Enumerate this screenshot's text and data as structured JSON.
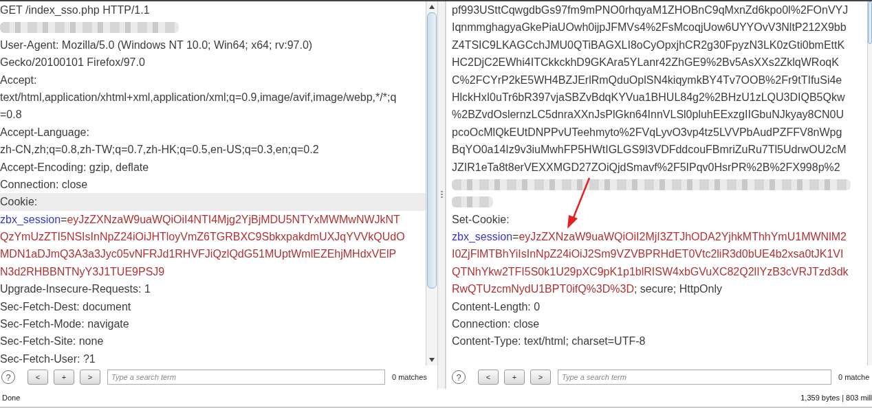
{
  "request": {
    "lines": [
      {
        "kind": "text",
        "highlighted": false,
        "segments": [
          {
            "kind": "plain",
            "text": "GET /index_sso.php HTTP/1.1"
          }
        ]
      },
      {
        "kind": "blurmedium",
        "highlighted": false
      },
      {
        "kind": "text",
        "highlighted": false,
        "segments": [
          {
            "kind": "plain",
            "text": "User-Agent: Mozilla/5.0 (Windows NT 10.0; Win64; x64; rv:97.0)"
          }
        ]
      },
      {
        "kind": "text",
        "highlighted": false,
        "segments": [
          {
            "kind": "plain",
            "text": "Gecko/20100101 Firefox/97.0"
          }
        ]
      },
      {
        "kind": "text",
        "highlighted": false,
        "segments": [
          {
            "kind": "plain",
            "text": "Accept:"
          }
        ]
      },
      {
        "kind": "text",
        "highlighted": false,
        "segments": [
          {
            "kind": "plain",
            "text": "text/html,application/xhtml+xml,application/xml;q=0.9,image/avif,image/webp,*/*;q"
          }
        ]
      },
      {
        "kind": "text",
        "highlighted": false,
        "segments": [
          {
            "kind": "plain",
            "text": "=0.8"
          }
        ]
      },
      {
        "kind": "text",
        "highlighted": false,
        "segments": [
          {
            "kind": "plain",
            "text": "Accept-Language:"
          }
        ]
      },
      {
        "kind": "text",
        "highlighted": false,
        "segments": [
          {
            "kind": "plain",
            "text": "zh-CN,zh;q=0.8,zh-TW;q=0.7,zh-HK;q=0.5,en-US;q=0.3,en;q=0.2"
          }
        ]
      },
      {
        "kind": "text",
        "highlighted": false,
        "segments": [
          {
            "kind": "plain",
            "text": "Accept-Encoding: gzip, deflate"
          }
        ]
      },
      {
        "kind": "text",
        "highlighted": false,
        "segments": [
          {
            "kind": "plain",
            "text": "Connection: close"
          }
        ]
      },
      {
        "kind": "text",
        "highlighted": true,
        "segments": [
          {
            "kind": "plain",
            "text": "Cookie:"
          }
        ]
      },
      {
        "kind": "text",
        "highlighted": false,
        "segments": [
          {
            "kind": "name",
            "text": "zbx_session"
          },
          {
            "kind": "plain",
            "text": "="
          },
          {
            "kind": "value",
            "text": "eyJzZXNzaW9uaWQiOiI4NTI4Mjg2YjBjMDU5NTYxMWMwNWJkNT"
          }
        ]
      },
      {
        "kind": "text",
        "highlighted": false,
        "segments": [
          {
            "kind": "value",
            "text": "QzYmUzZTI5NSIsInNpZ24iOiJHTloyVmZ6TGRBXC9SbkxpakdmUXJqYVVkQUdO"
          }
        ]
      },
      {
        "kind": "text",
        "highlighted": false,
        "segments": [
          {
            "kind": "value",
            "text": "MDN1aDJmQ3A3a3Jyc05vNFRJd1RHVFJiQzlQdG51MUptWmlEZEhjMHdxVElP"
          }
        ]
      },
      {
        "kind": "text",
        "highlighted": false,
        "segments": [
          {
            "kind": "value",
            "text": "N3d2RHBBNTNyY3J1TUE9PSJ9"
          }
        ]
      },
      {
        "kind": "text",
        "highlighted": false,
        "segments": [
          {
            "kind": "plain",
            "text": "Upgrade-Insecure-Requests: 1"
          }
        ]
      },
      {
        "kind": "text",
        "highlighted": false,
        "segments": [
          {
            "kind": "plain",
            "text": "Sec-Fetch-Dest: document"
          }
        ]
      },
      {
        "kind": "text",
        "highlighted": false,
        "segments": [
          {
            "kind": "plain",
            "text": "Sec-Fetch-Mode: navigate"
          }
        ]
      },
      {
        "kind": "text",
        "highlighted": false,
        "segments": [
          {
            "kind": "plain",
            "text": "Sec-Fetch-Site: none"
          }
        ]
      },
      {
        "kind": "text",
        "highlighted": false,
        "segments": [
          {
            "kind": "plain",
            "text": "Sec-Fetch-User: ?1"
          }
        ]
      }
    ],
    "help": "?",
    "buttons": [
      "<",
      "+",
      ">"
    ],
    "search": {
      "placeholder": "Type a search term"
    },
    "matches": "0 matches"
  },
  "response": {
    "lines": [
      {
        "kind": "text",
        "highlighted": false,
        "segments": [
          {
            "kind": "plain",
            "text": "pf993USttCqwgdbGs97fm9mPNO0rhqyaM1ZHOBnC9qMxnZd6kpo0l%2FOnVYJ"
          }
        ]
      },
      {
        "kind": "text",
        "highlighted": false,
        "segments": [
          {
            "kind": "plain",
            "text": "IqnmmghagyaGkePiaUOwh0ijpJFMVs4%2FsMcoqjUow6UYYOvV3NltP212X9bb"
          }
        ]
      },
      {
        "kind": "text",
        "highlighted": false,
        "segments": [
          {
            "kind": "plain",
            "text": "Z4TSIC9LKAGCchJMU0QTiBAGXLI8oCyOpxjhCR2g30FpyzN3LK0zGti0bmEttK"
          }
        ]
      },
      {
        "kind": "text",
        "highlighted": false,
        "segments": [
          {
            "kind": "plain",
            "text": "HC2DjC2EWhi4ITCkkckhD9GKAra5YLanr42ZhGE9%2Bv5AsXXs2ZklqWRoqK"
          }
        ]
      },
      {
        "kind": "text",
        "highlighted": false,
        "segments": [
          {
            "kind": "plain",
            "text": "C%2FCYrP2kE5WH4BZJErlRmQduOplSN4kiqymkBY4Tv7OOB%2Fr9tTIfuSi4e"
          }
        ]
      },
      {
        "kind": "text",
        "highlighted": false,
        "segments": [
          {
            "kind": "plain",
            "text": "HlckHxI0uTr6bR397vjaSBZvBdqKYVua1BHUL84g2%2BHzU1zLQU3DIQB5Qkw"
          }
        ]
      },
      {
        "kind": "text",
        "highlighted": false,
        "segments": [
          {
            "kind": "plain",
            "text": "%2BZvdOslernzLC5dnraXXnJsPlGkn64InnVLSl0pluhEExzgIIGbuNJkyay8CN0U"
          }
        ]
      },
      {
        "kind": "text",
        "highlighted": false,
        "segments": [
          {
            "kind": "plain",
            "text": "pcoOcMlQkEUtDNPPvUTeehmyto%2FVqLyvO3vp4tz5LVVPbAudPZFFV8nWpg"
          }
        ]
      },
      {
        "kind": "text",
        "highlighted": false,
        "segments": [
          {
            "kind": "plain",
            "text": "BqYO0a14Iz9v3iuMwhFP5HWtIGLGS9l3VDFddcouFBmriZuRu7Tl5UdrwOU2cM"
          }
        ]
      },
      {
        "kind": "text",
        "highlighted": false,
        "segments": [
          {
            "kind": "plain",
            "text": "JZIR1eTa8t8erVEXXMGD27ZOiQjdSmavf%2F5IPqv0HsrPR%2B%2FX998p%2"
          }
        ]
      },
      {
        "kind": "blurlong",
        "highlighted": false
      },
      {
        "kind": "blurshort",
        "highlighted": false
      },
      {
        "kind": "text",
        "highlighted": false,
        "segments": [
          {
            "kind": "plain",
            "text": "Set-Cookie:"
          }
        ]
      },
      {
        "kind": "text",
        "highlighted": false,
        "segments": [
          {
            "kind": "name",
            "text": "zbx_session"
          },
          {
            "kind": "plain",
            "text": "="
          },
          {
            "kind": "value",
            "text": "eyJzZXNzaW9uaWQiOiI2MjI3ZTJhODA2YjhkMThhYmU1MWNlM2"
          }
        ]
      },
      {
        "kind": "text",
        "highlighted": false,
        "segments": [
          {
            "kind": "value",
            "text": "I0ZjFlMTBhYiIsInNpZ24iOiJ2Sm9VZVBPRHdET0Vtc2liR3d0bUE4b2xsa0tJK1VI"
          }
        ]
      },
      {
        "kind": "text",
        "highlighted": false,
        "segments": [
          {
            "kind": "value",
            "text": "QTNhYkw2TFI5S0k1U29pXC9pK1p1blRISW4xbGVuXC82Q2lIYzB3cVRJTzd3dk"
          }
        ]
      },
      {
        "kind": "text",
        "highlighted": false,
        "segments": [
          {
            "kind": "value",
            "text": "RwQTUzcmNydU1BPT0ifQ%3D%3D"
          },
          {
            "kind": "plain",
            "text": "; secure; HttpOnly"
          }
        ]
      },
      {
        "kind": "text",
        "highlighted": false,
        "segments": [
          {
            "kind": "plain",
            "text": "Content-Length: 0"
          }
        ]
      },
      {
        "kind": "text",
        "highlighted": false,
        "segments": [
          {
            "kind": "plain",
            "text": "Connection: close"
          }
        ]
      },
      {
        "kind": "text",
        "highlighted": false,
        "segments": [
          {
            "kind": "plain",
            "text": "Content-Type: text/html; charset=UTF-8"
          }
        ]
      }
    ],
    "help": "?",
    "buttons": [
      "<",
      "+",
      ">"
    ],
    "search": {
      "placeholder": "Type a search term"
    },
    "matches": "0 matche"
  },
  "status_bar": {
    "left": "Done",
    "right": "1,359 bytes | 803 mill"
  }
}
